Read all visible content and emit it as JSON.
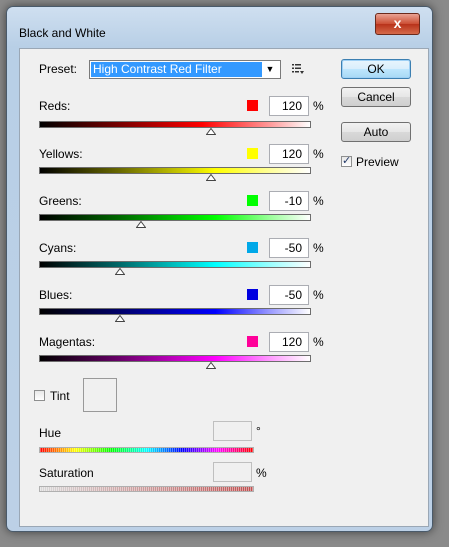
{
  "window": {
    "title": "Black and White",
    "close_glyph": "x"
  },
  "preset": {
    "label": "Preset:",
    "value": "High Contrast Red Filter",
    "arrow": "▼",
    "menu_icon": "preset-options-icon"
  },
  "buttons": {
    "ok": "OK",
    "cancel": "Cancel",
    "auto": "Auto"
  },
  "preview": {
    "label": "Preview",
    "checked": true,
    "mark": "✓"
  },
  "channels": [
    {
      "label": "Reds:",
      "value": "120",
      "unit": "%",
      "color": "#ff0000"
    },
    {
      "label": "Yellows:",
      "value": "120",
      "unit": "%",
      "color": "#ffff00"
    },
    {
      "label": "Greens:",
      "value": "-10",
      "unit": "%",
      "color": "#00ff00"
    },
    {
      "label": "Cyans:",
      "value": "-50",
      "unit": "%",
      "color": "#00a8e8"
    },
    {
      "label": "Blues:",
      "value": "-50",
      "unit": "%",
      "color": "#0000e0"
    },
    {
      "label": "Magentas:",
      "value": "120",
      "unit": "%",
      "color": "#ff0099"
    }
  ],
  "tint": {
    "label": "Tint",
    "checked": false
  },
  "hue": {
    "label": "Hue",
    "unit": "°"
  },
  "saturation": {
    "label": "Saturation",
    "unit": "%"
  }
}
